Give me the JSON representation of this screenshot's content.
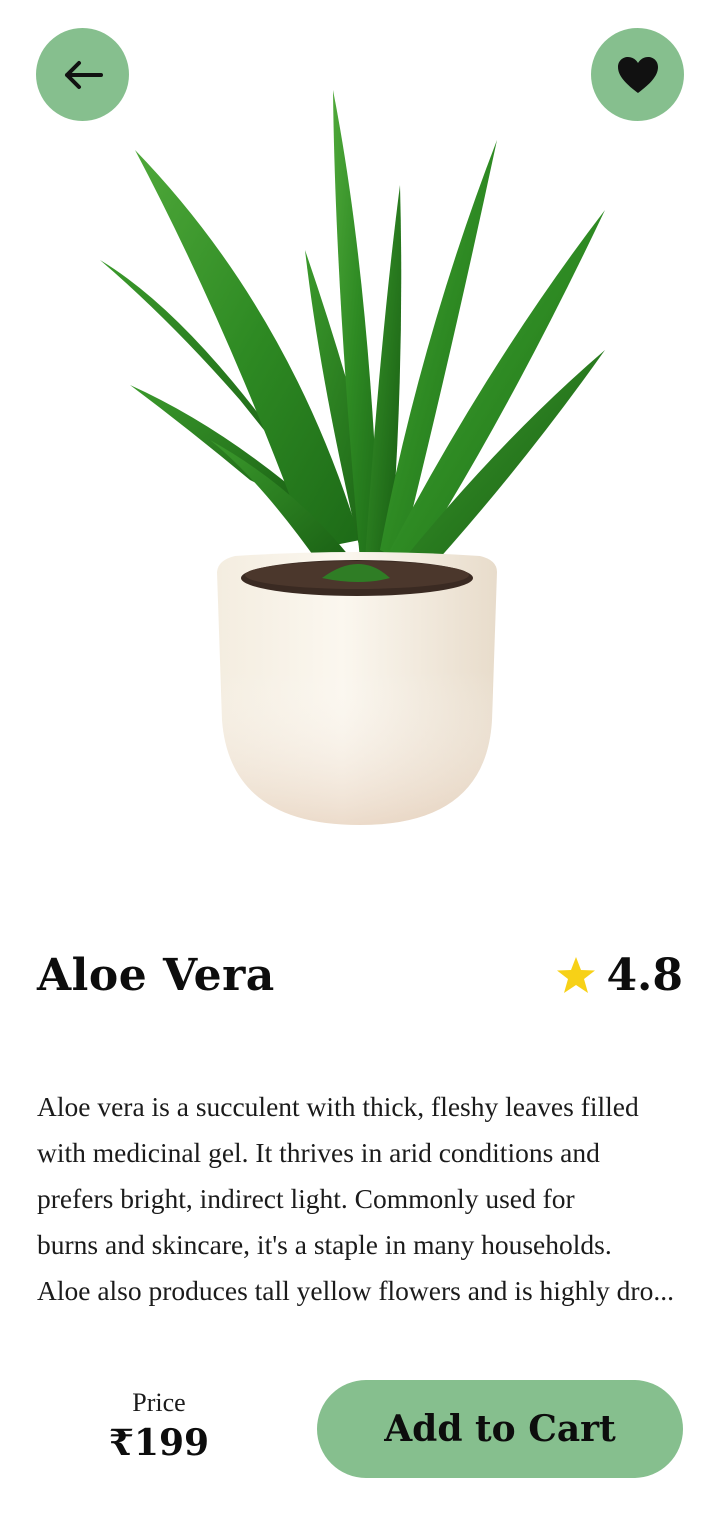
{
  "header": {
    "back_icon": "arrow-left-icon",
    "favorite_icon": "heart-icon"
  },
  "product": {
    "name": "Aloe Vera",
    "rating": "4.8",
    "rating_icon": "star-icon",
    "description_lines": [
      "Aloe vera is a succulent with thick, fleshy leaves filled",
      "with medicinal gel. It thrives in arid conditions and",
      "prefers bright, indirect light. Commonly used for",
      "burns and skincare, it's a staple in many households.",
      "Aloe also produces tall yellow flowers and is highly dro..."
    ]
  },
  "footer": {
    "price_label": "Price",
    "price_value": "₹199",
    "add_to_cart_label": "Add to Cart"
  },
  "colors": {
    "accent": "#86bf8e",
    "star": "#f7d117",
    "text": "#111111"
  }
}
